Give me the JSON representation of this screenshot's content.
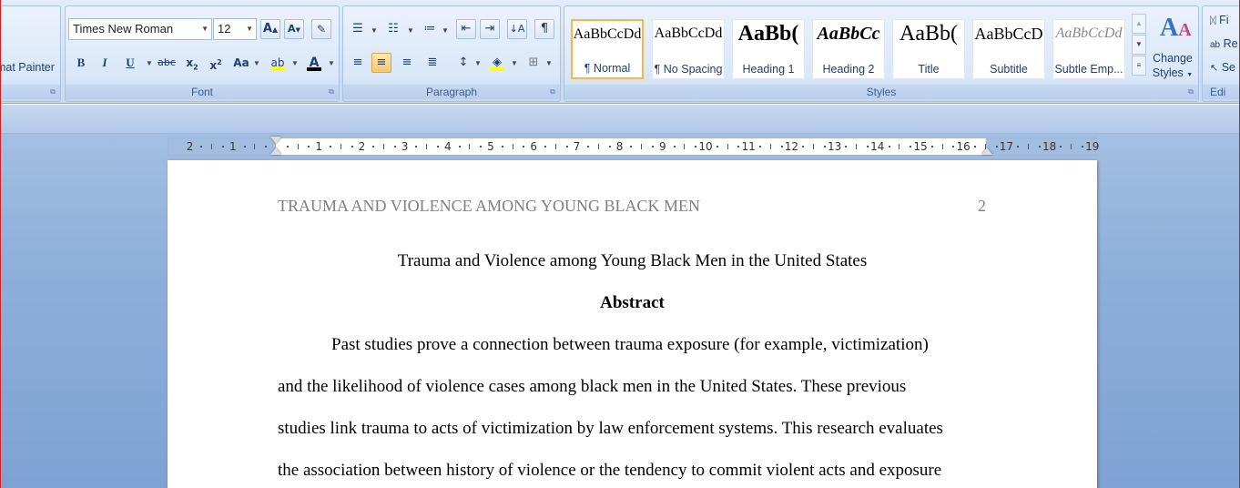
{
  "clipboard": {
    "format_painter_label": "mat Painter"
  },
  "font": {
    "name": "Times New Roman",
    "size": "12",
    "group_label": "Font"
  },
  "paragraph": {
    "group_label": "Paragraph"
  },
  "styles": {
    "group_label": "Styles",
    "tiles": [
      {
        "sample": "AaBbCcDd",
        "name": "¶ Normal"
      },
      {
        "sample": "AaBbCcDd",
        "name": "¶ No Spacing"
      },
      {
        "sample": "AaBb(",
        "name": "Heading 1"
      },
      {
        "sample": "AaBbCc",
        "name": "Heading 2"
      },
      {
        "sample": "AaBb(",
        "name": "Title"
      },
      {
        "sample": "AaBbCcD",
        "name": "Subtitle"
      },
      {
        "sample": "AaBbCcDd",
        "name": "Subtle Emp..."
      }
    ],
    "selected_index": 0,
    "change_styles_label": "Change",
    "change_styles_label2": "Styles"
  },
  "editing": {
    "find_label": "Fi",
    "replace_label": "Re",
    "select_label": "Se",
    "group_label": "Edi"
  },
  "ruler": {
    "left_numbers": [
      "2",
      "1"
    ],
    "right_numbers": [
      "1",
      "2",
      "3",
      "4",
      "5",
      "6",
      "7",
      "8",
      "9",
      "10",
      "11",
      "12",
      "13",
      "14",
      "15",
      "16",
      "17",
      "18",
      "19"
    ]
  },
  "document": {
    "running_head": "TRAUMA AND VIOLENCE AMONG YOUNG BLACK MEN",
    "page_number": "2",
    "title": "Trauma and Violence among Young Black Men in the United States",
    "abstract_heading": "Abstract",
    "lines": [
      "Past studies prove a connection between trauma exposure (for example, victimization)",
      "and the likelihood of violence cases among black men in the United States. These previous",
      "studies link trauma to acts of victimization by law enforcement systems. This research evaluates",
      "the association between history of violence or the tendency to commit violent acts and exposure"
    ]
  },
  "colors": {
    "accent": "#1f3f73",
    "selected_style_border": "#f2b84b",
    "header_gray": "#7f7f7f"
  }
}
